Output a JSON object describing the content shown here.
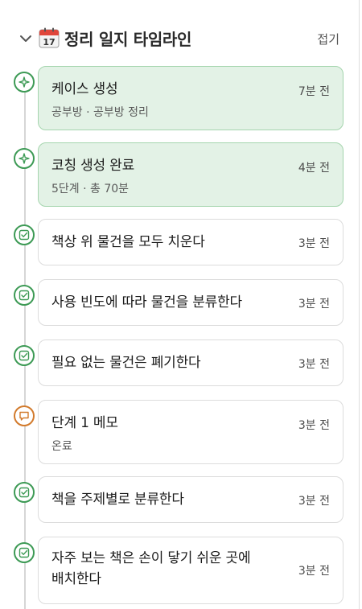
{
  "header": {
    "title": "정리 일지 타임라인",
    "collapse_label": "접기",
    "calendar_day": "17"
  },
  "events": [
    {
      "type": "ai",
      "title": "케이스 생성",
      "subtitle": "공부방 · 공부방 정리",
      "time": "7분 전",
      "highlight": true
    },
    {
      "type": "ai",
      "title": "코칭 생성 완료",
      "subtitle": "5단계 · 총 70분",
      "time": "4분 전",
      "highlight": true
    },
    {
      "type": "task",
      "title": "책상 위 물건을 모두 치운다",
      "time": "3분 전"
    },
    {
      "type": "task",
      "title": "사용 빈도에 따라 물건을 분류한다",
      "time": "3분 전"
    },
    {
      "type": "task",
      "title": "필요 없는 물건은 폐기한다",
      "time": "3분 전"
    },
    {
      "type": "memo",
      "title": "단계 1 메모",
      "subtitle": "온료",
      "time": "3분 전"
    },
    {
      "type": "task",
      "title": "책을 주제별로 분류한다",
      "time": "3분 전"
    },
    {
      "type": "task",
      "title": "자주 보는 책은 손이 닿기 쉬운 곳에",
      "title_line2": "배치한다",
      "time": "3분 전"
    }
  ],
  "colors": {
    "accent_green": "#3d9a55",
    "memo_orange": "#d27a2c",
    "highlight_bg": "#e3f2e6"
  }
}
